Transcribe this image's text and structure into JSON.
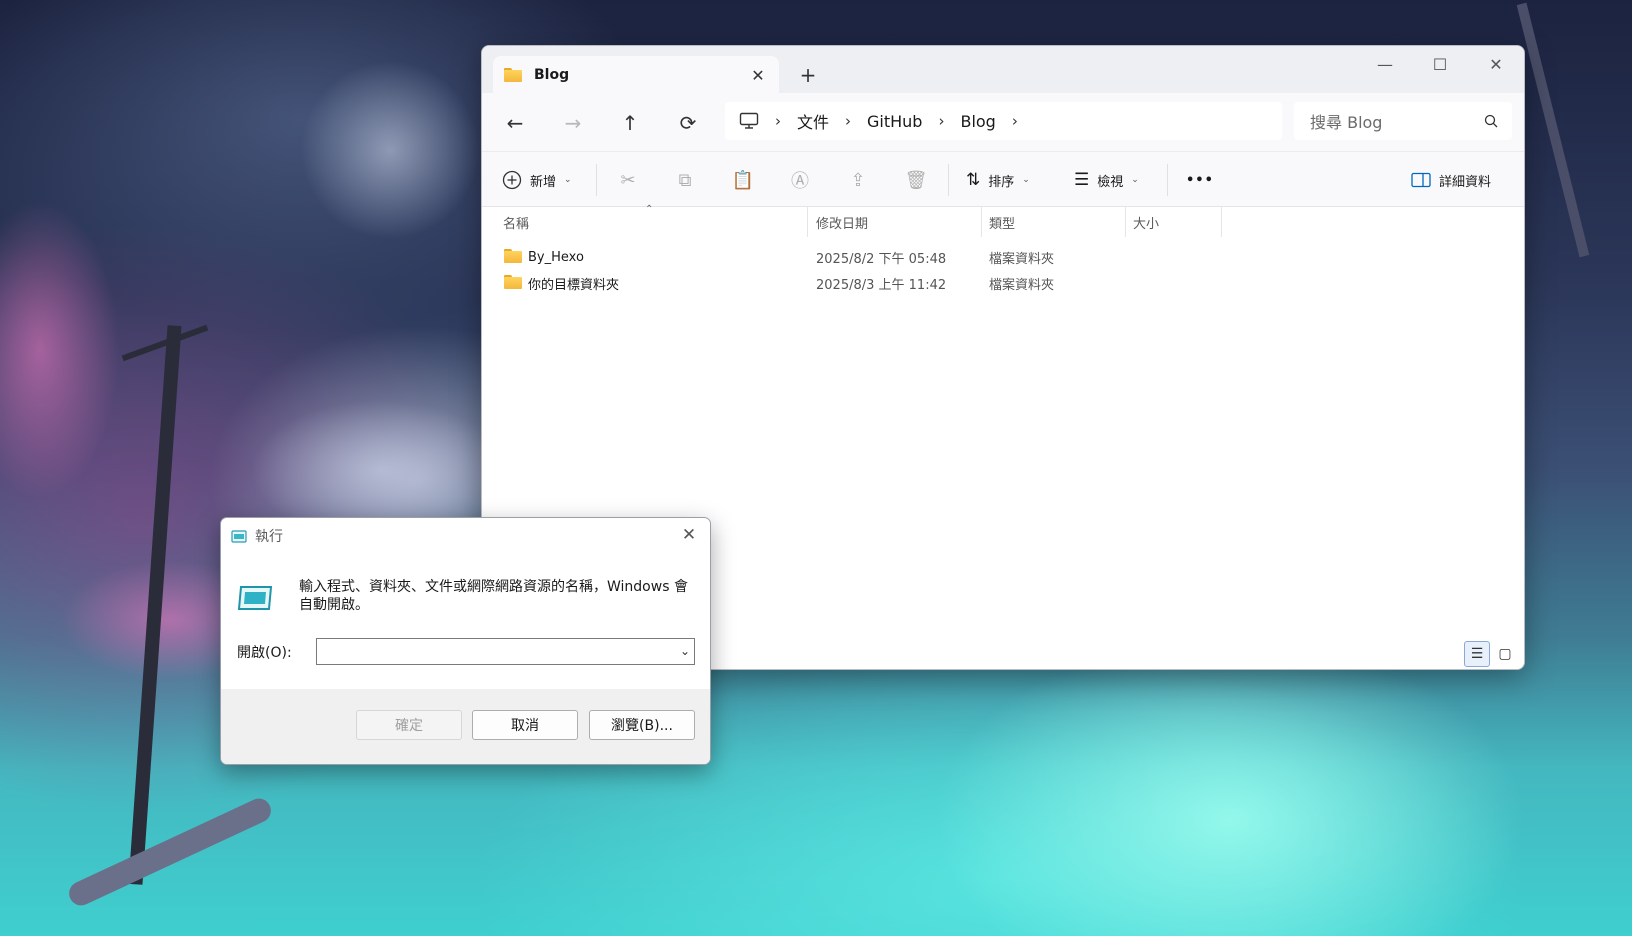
{
  "explorer": {
    "tab_title": "Blog",
    "tab_close": "✕",
    "new_tab": "+",
    "window_controls": {
      "minimize": "—",
      "maximize": "☐",
      "close": "✕"
    },
    "nav": {
      "back": "←",
      "forward": "→",
      "up": "↑",
      "refresh": "⟳"
    },
    "breadcrumb": [
      "文件",
      "GitHub",
      "Blog"
    ],
    "search_placeholder": "搜尋 Blog",
    "toolbar": {
      "new_label": "新增",
      "sort_label": "排序",
      "view_label": "檢視",
      "more_label": "•••",
      "details_label": "詳細資料"
    },
    "columns": [
      "名稱",
      "修改日期",
      "類型",
      "大小"
    ],
    "files": [
      {
        "name": "By_Hexo",
        "date": "2025/8/2 下午 05:48",
        "type": "檔案資料夾",
        "size": ""
      },
      {
        "name": "你的目標資料夾",
        "date": "2025/8/3 上午 11:42",
        "type": "檔案資料夾",
        "size": ""
      }
    ]
  },
  "run_dialog": {
    "title": "執行",
    "description": "輸入程式、資料夾、文件或網際網路資源的名稱，Windows 會自動開啟。",
    "open_label": "開啟(O):",
    "input_value": "",
    "ok_label": "確定",
    "cancel_label": "取消",
    "browse_label": "瀏覽(B)..."
  },
  "colors": {
    "accent": "#0067c0",
    "folder": "#f4b73c",
    "window_bg": "#f9f9fb"
  }
}
